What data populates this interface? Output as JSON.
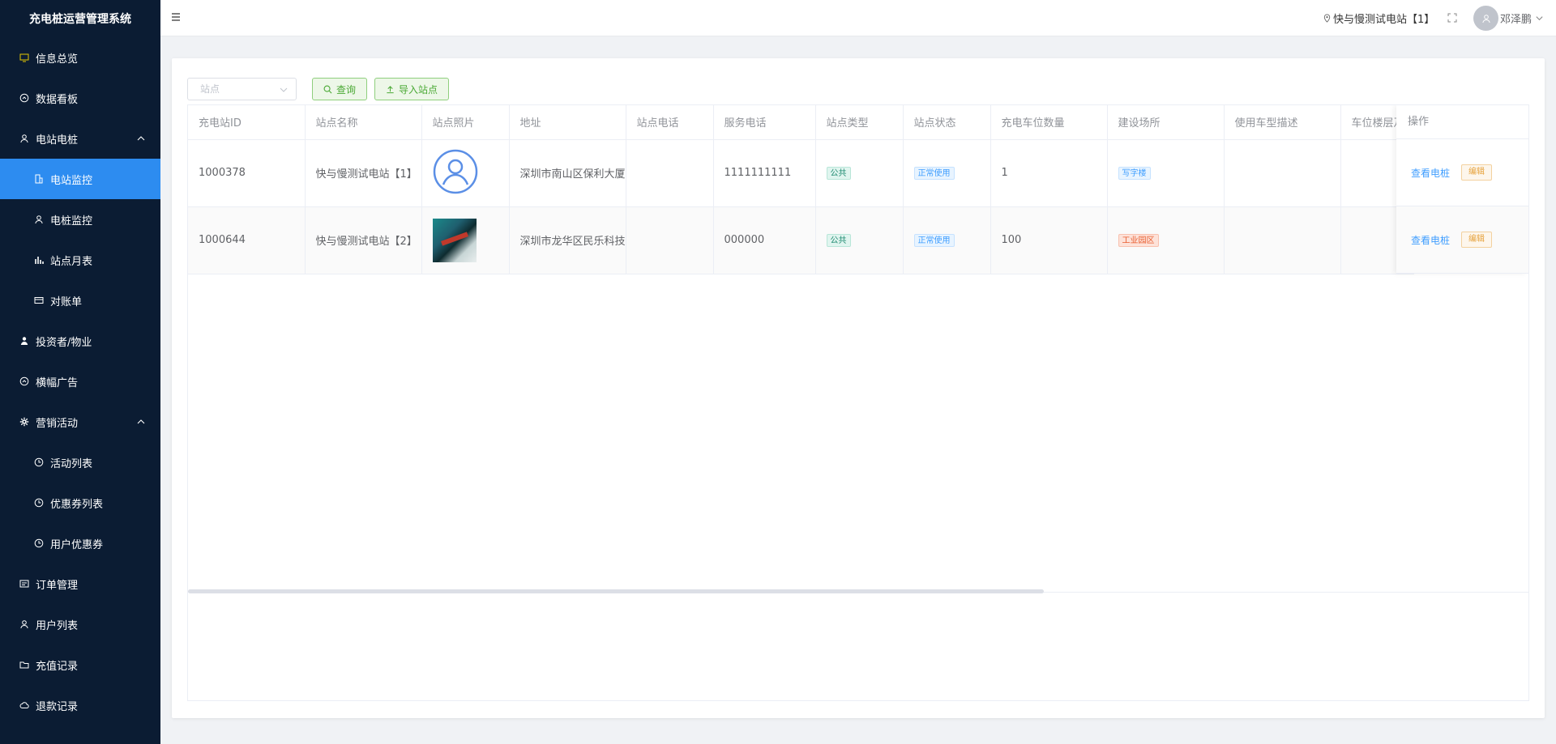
{
  "sidebar": {
    "title": "充电桩运营管理系统",
    "items": [
      {
        "label": "信息总览",
        "icon": "monitor-icon",
        "sub": false
      },
      {
        "label": "数据看板",
        "icon": "dashboard-icon",
        "sub": false
      },
      {
        "label": "电站电桩",
        "icon": "user-group-icon",
        "sub": false,
        "expanded": true
      },
      {
        "label": "电站监控",
        "icon": "building-icon",
        "sub": true,
        "active": true
      },
      {
        "label": "电桩监控",
        "icon": "user-icon",
        "sub": true
      },
      {
        "label": "站点月表",
        "icon": "bar-chart-icon",
        "sub": true
      },
      {
        "label": "对账单",
        "icon": "card-icon",
        "sub": true
      },
      {
        "label": "投资者/物业",
        "icon": "person-icon",
        "sub": false
      },
      {
        "label": "横幅广告",
        "icon": "dashboard-icon",
        "sub": false
      },
      {
        "label": "营销活动",
        "icon": "gear-icon",
        "sub": false,
        "expanded": true
      },
      {
        "label": "活动列表",
        "icon": "clock-icon",
        "sub": true
      },
      {
        "label": "优惠券列表",
        "icon": "clock-icon",
        "sub": true
      },
      {
        "label": "用户优惠券",
        "icon": "clock-icon",
        "sub": true
      },
      {
        "label": "订单管理",
        "icon": "list-icon",
        "sub": false
      },
      {
        "label": "用户列表",
        "icon": "user-icon",
        "sub": false
      },
      {
        "label": "充值记录",
        "icon": "folder-icon",
        "sub": false
      },
      {
        "label": "退款记录",
        "icon": "cloud-icon",
        "sub": false
      }
    ]
  },
  "header": {
    "station": "快与慢测试电站【1】",
    "username": "邓泽鹏"
  },
  "toolbar": {
    "select_placeholder": "站点",
    "query_label": "查询",
    "import_label": "导入站点"
  },
  "table": {
    "columns": [
      "充电站ID",
      "站点名称",
      "站点照片",
      "地址",
      "站点电话",
      "服务电话",
      "站点类型",
      "站点状态",
      "充电车位数量",
      "建设场所",
      "使用车型描述",
      "车位楼层及"
    ],
    "op_header": "操作",
    "rows": [
      {
        "id": "1000378",
        "name": "快与慢测试电站【1】",
        "address": "深圳市南山区保利大厦",
        "phone": "",
        "service_phone": "1111111111",
        "type": "公共",
        "status": "正常使用",
        "spots": "1",
        "site": "写字楼",
        "site_color": "blue",
        "vehicle": "",
        "floor": ""
      },
      {
        "id": "1000644",
        "name": "快与慢测试电站【2】",
        "address": "深圳市龙华区民乐科技",
        "phone": "",
        "service_phone": "000000",
        "type": "公共",
        "status": "正常使用",
        "spots": "100",
        "site": "工业园区",
        "site_color": "red",
        "vehicle": "",
        "floor": ""
      }
    ],
    "op_view_label": "查看电桩",
    "op_edit_label": "编辑"
  },
  "colors": {
    "sidebar_bg": "#0b1c33",
    "active_item": "#2d8cf0",
    "accent_green": "#4aa935"
  }
}
